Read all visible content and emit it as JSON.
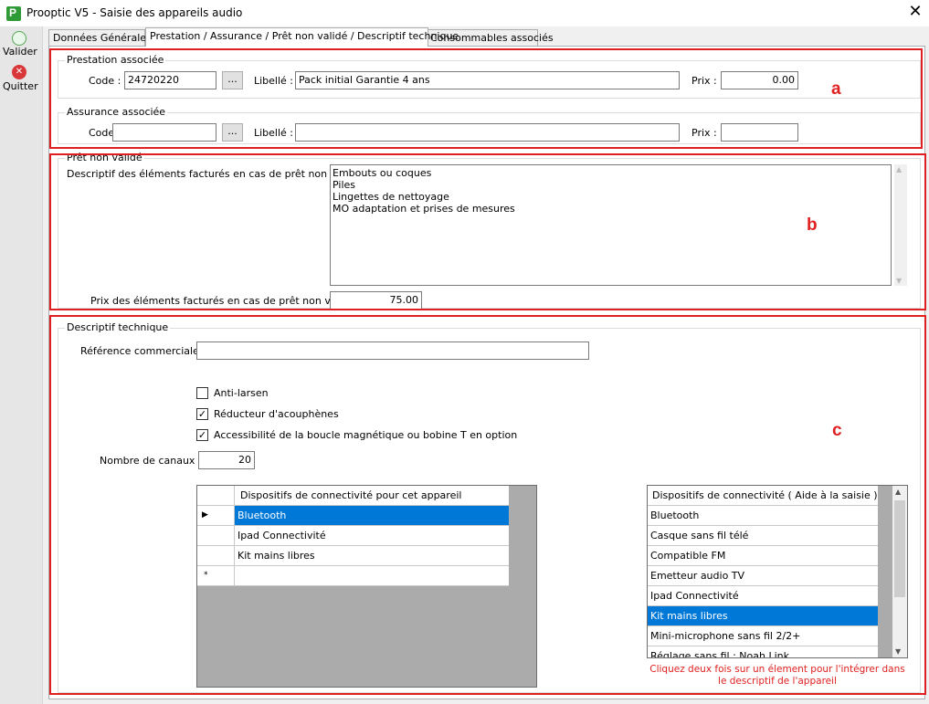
{
  "window": {
    "title": "Prooptic V5 - Saisie des appareils audio",
    "close_glyph": "✕"
  },
  "toolbar": {
    "valider_label": "Valider",
    "quitter_label": "Quitter"
  },
  "tabs": [
    {
      "label": "Données Générales",
      "active": false
    },
    {
      "label": "Prestation / Assurance / Prêt non validé / Descriptif technique",
      "active": true
    },
    {
      "label": "Consommables associés",
      "active": false
    }
  ],
  "prestation": {
    "group_title": "Prestation associée",
    "code_label": "Code :",
    "code_value": "24720220",
    "browse_label": "...",
    "libelle_label": "Libellé :",
    "libelle_value": "Pack initial Garantie 4 ans",
    "prix_label": "Prix :",
    "prix_value": "0.00"
  },
  "assurance": {
    "group_title": "Assurance associée",
    "code_label": "Code :",
    "code_value": "",
    "browse_label": "...",
    "libelle_label": "Libellé :",
    "libelle_value": "",
    "prix_label": "Prix :",
    "prix_value": ""
  },
  "pret": {
    "group_title": "Prêt non validé",
    "desc_label": "Descriptif des éléments facturés en cas de prêt non validé :",
    "desc_lines": [
      "Embouts ou coques",
      "Piles",
      "Lingettes de nettoyage",
      "MO adaptation et prises de mesures"
    ],
    "prix_label": "Prix des éléments facturés en cas de prêt non validé :",
    "prix_value": "75.00"
  },
  "technique": {
    "group_title": "Descriptif technique",
    "ref_label": "Référence commerciale :",
    "ref_value": "",
    "checkboxes": [
      {
        "label": "Anti-larsen",
        "checked": false
      },
      {
        "label": "Réducteur d'acouphènes",
        "checked": true
      },
      {
        "label": "Accessibilité de la boucle magnétique ou bobine T en option",
        "checked": true
      }
    ],
    "canaux_label": "Nombre de canaux :",
    "canaux_value": "20",
    "device_grid": {
      "header": "Dispositifs de connectivité pour cet appareil",
      "rows": [
        "Bluetooth",
        "Ipad Connectivité",
        "Kit mains libres",
        ""
      ],
      "selected_index": 0,
      "current_marker": "▶",
      "new_row_marker": "*"
    },
    "help_grid": {
      "header": "Dispositifs de connectivité ( Aide à la saisie )",
      "rows": [
        "Bluetooth",
        "Casque sans fil télé",
        "Compatible FM",
        "Emetteur audio TV",
        "Ipad Connectivité",
        "Kit mains libres",
        "Mini-microphone sans fil 2/2+",
        "Réglage sans fil : Noah Link"
      ],
      "selected_index": 5,
      "scroll_up": "▲",
      "scroll_down": "▼"
    },
    "hint_text": "Cliquez deux fois sur un élement pour l'intégrer dans le descriptif de l'appareil"
  },
  "annotations": {
    "a": "a",
    "b": "b",
    "c": "c"
  },
  "colors": {
    "annotation_red": "#e02020",
    "selection_blue": "#0078d7",
    "hint_red": "#e02020"
  }
}
